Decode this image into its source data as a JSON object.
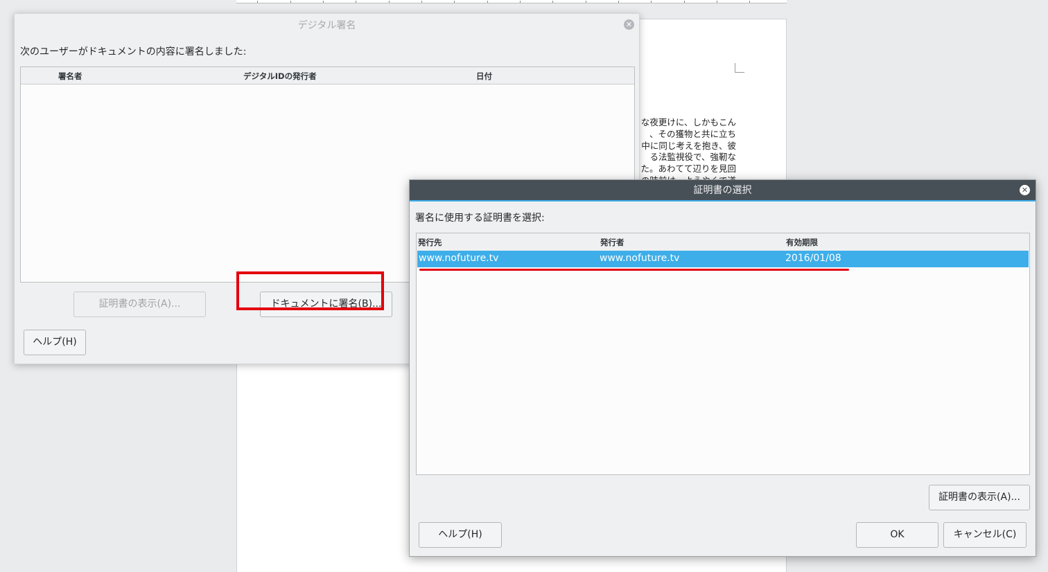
{
  "document": {
    "text_lines": [
      "な夜更けに、しかもこん",
      "、その獲物と共に立ち",
      "中に同じ考えを抱き、彼",
      "る法監視役で、強靭な",
      "た。あわてて辺りを見回",
      "の時前は、ようやくで道"
    ]
  },
  "digital_signatures_dialog": {
    "title": "デジタル署名",
    "label": "次のユーザーがドキュメントの内容に署名しました:",
    "columns": [
      "署名者",
      "デジタルIDの発行者",
      "日付"
    ],
    "rows": [],
    "buttons": {
      "view_certificate": "証明書の表示(A)...",
      "sign_document": "ドキュメントに署名(B)...",
      "help": "ヘルプ(H)"
    }
  },
  "select_certificate_dialog": {
    "title": "証明書の選択",
    "label": "署名に使用する証明書を選択:",
    "columns": [
      "発行先",
      "発行者",
      "有効期限"
    ],
    "rows": [
      {
        "issued_to": "www.nofuture.tv",
        "issuer": "www.nofuture.tv",
        "expiry": "2016/01/08",
        "selected": true
      }
    ],
    "buttons": {
      "view_certificate": "証明書の表示(A)...",
      "help": "ヘルプ(H)",
      "ok": "OK",
      "cancel": "キャンセル(C)"
    }
  },
  "colors": {
    "selection": "#3daee9",
    "highlight": "#e3000f",
    "titlebar": "#475057"
  }
}
